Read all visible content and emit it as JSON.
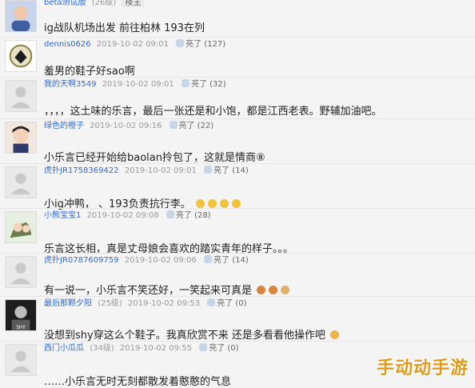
{
  "comments": [
    {
      "user": "beta测试版",
      "level": "(26级)",
      "badge": "楼主",
      "time": "",
      "likes": "",
      "text": "ig战队机场出发 前往柏林 193在列"
    },
    {
      "user": "dennis0626",
      "level": "",
      "badge": "",
      "time": "2019-10-02 09:01",
      "likes": "亮了 (127)",
      "text": "羞男的鞋子好sao啊"
    },
    {
      "user": "我的天啊3549",
      "level": "",
      "badge": "",
      "time": "2019-10-02 09:01",
      "likes": "亮了 (32)",
      "text": "，，，，这土味的乐言，最后一张还是和小饱，都是江西老表。野辅加油吧。"
    },
    {
      "user": "绿色的橙子",
      "level": "",
      "badge": "",
      "time": "2019-10-02 09:16",
      "likes": "亮了 (22)",
      "text": "小乐言已经开始给baolan拎包了，这就是情商⑧"
    },
    {
      "user": "虎扑JR1758369422",
      "level": "",
      "badge": "",
      "time": "2019-10-02 09:01",
      "likes": "亮了 (14)",
      "text": "小ig冲鸭，   、193负责抗行李。"
    },
    {
      "user": "小熊宝宝1",
      "level": "",
      "badge": "",
      "time": "2019-10-02 09:08",
      "likes": "亮了 (28)",
      "text": "乐言这长相，真是丈母娘会喜欢的踏实青年的样子。。。"
    },
    {
      "user": "虎扑JR0787609759",
      "level": "",
      "badge": "",
      "time": "2019-10-02 09:06",
      "likes": "亮了 (14)",
      "text": "有一说一，小乐言不笑还好，一笑起来可真是"
    },
    {
      "user": "最后那颗夕阳",
      "level": "(25级)",
      "badge": "",
      "time": "2019-10-02 09:53",
      "likes": "亮了 (0)",
      "text": "没想到shy穿这么个鞋子。我真欣赏不来 还是多看看他操作吧"
    },
    {
      "user": "西门小瓜瓜",
      "level": "(34级)",
      "badge": "",
      "time": "2019-10-02 09:55",
      "likes": "亮了 (0)",
      "text": "……小乐言无时无刻都散发着憨憨的气息"
    }
  ],
  "watermark": "手动动手游",
  "colors": {
    "username": "#2f6bd6",
    "meta": "#9a9a9a",
    "background": "#f4f4f4",
    "watermark": "#e39a1a"
  }
}
